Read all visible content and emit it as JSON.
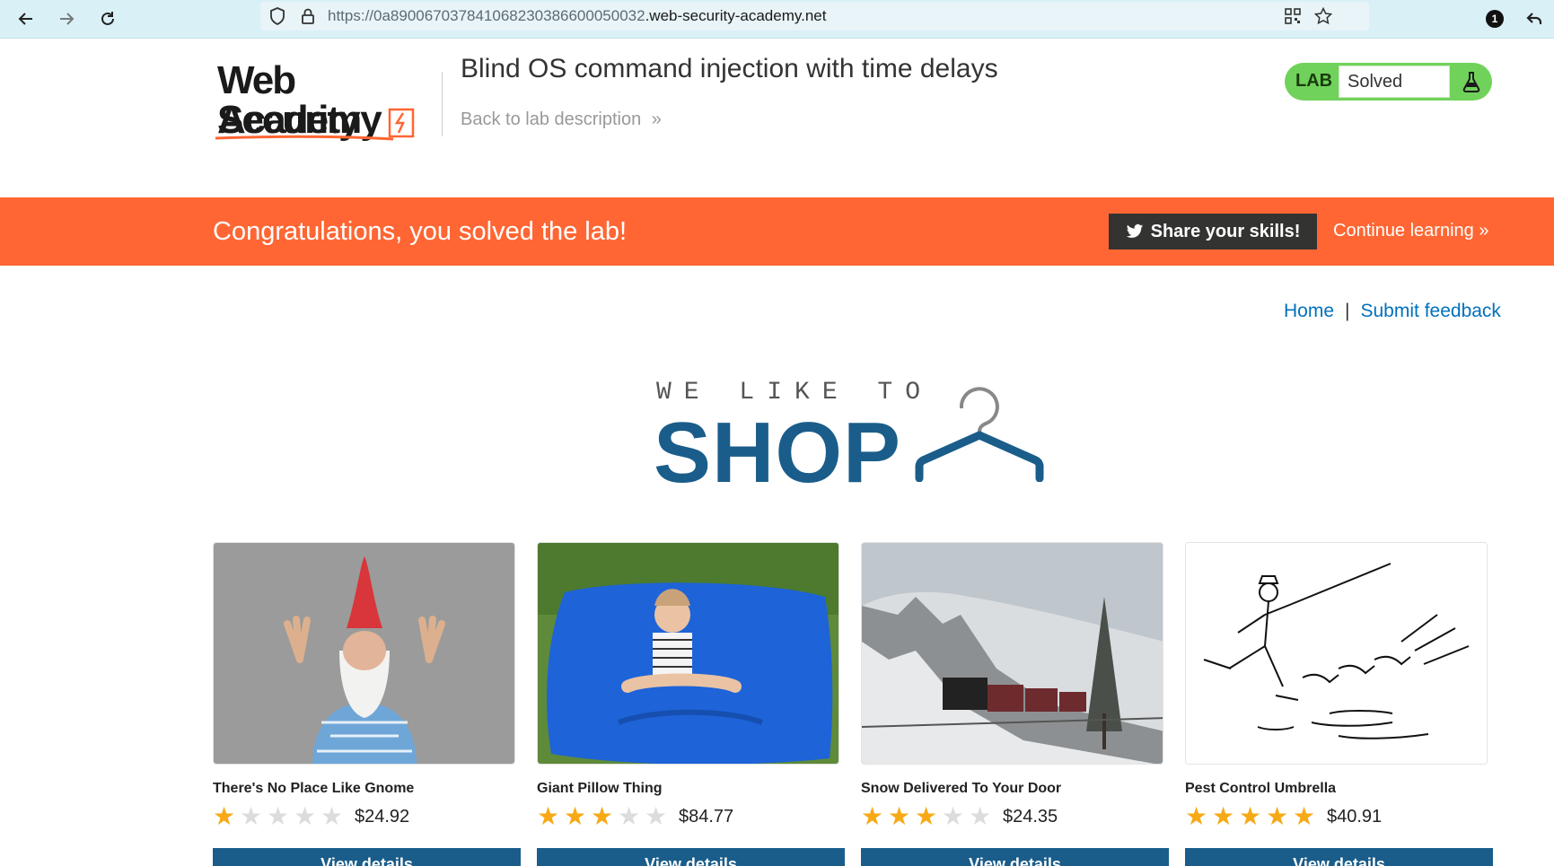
{
  "browser": {
    "url_prefix": "https://0a890067037841068230386600050032",
    "url_domain": ".web-security-academy.net",
    "notification_count": "1"
  },
  "header": {
    "logo_line1": "Web Security",
    "logo_line2": "Academy",
    "lab_title": "Blind OS command injection with time delays",
    "back_link": "Back to lab description",
    "lab_tag": "LAB",
    "lab_status": "Solved"
  },
  "banner": {
    "message": "Congratulations, you solved the lab!",
    "share_label": "Share your skills!",
    "continue_label": "Continue learning"
  },
  "nav": {
    "home": "Home",
    "separator": "|",
    "feedback": "Submit feedback"
  },
  "hero": {
    "tagline": "WE LIKE TO",
    "word": "SHOP"
  },
  "products": [
    {
      "name": "There's No Place Like Gnome",
      "rating": 1,
      "price": "$24.92",
      "button": "View details"
    },
    {
      "name": "Giant Pillow Thing",
      "rating": 3,
      "price": "$84.77",
      "button": "View details"
    },
    {
      "name": "Snow Delivered To Your Door",
      "rating": 3,
      "price": "$24.35",
      "button": "View details"
    },
    {
      "name": "Pest Control Umbrella",
      "rating": 5,
      "price": "$40.91",
      "button": "View details"
    }
  ],
  "colors": {
    "accent": "#ff6633",
    "brand_blue": "#1a5d8a",
    "link": "#0071bc",
    "solved_green": "#70d25a",
    "star": "#f7a915"
  }
}
